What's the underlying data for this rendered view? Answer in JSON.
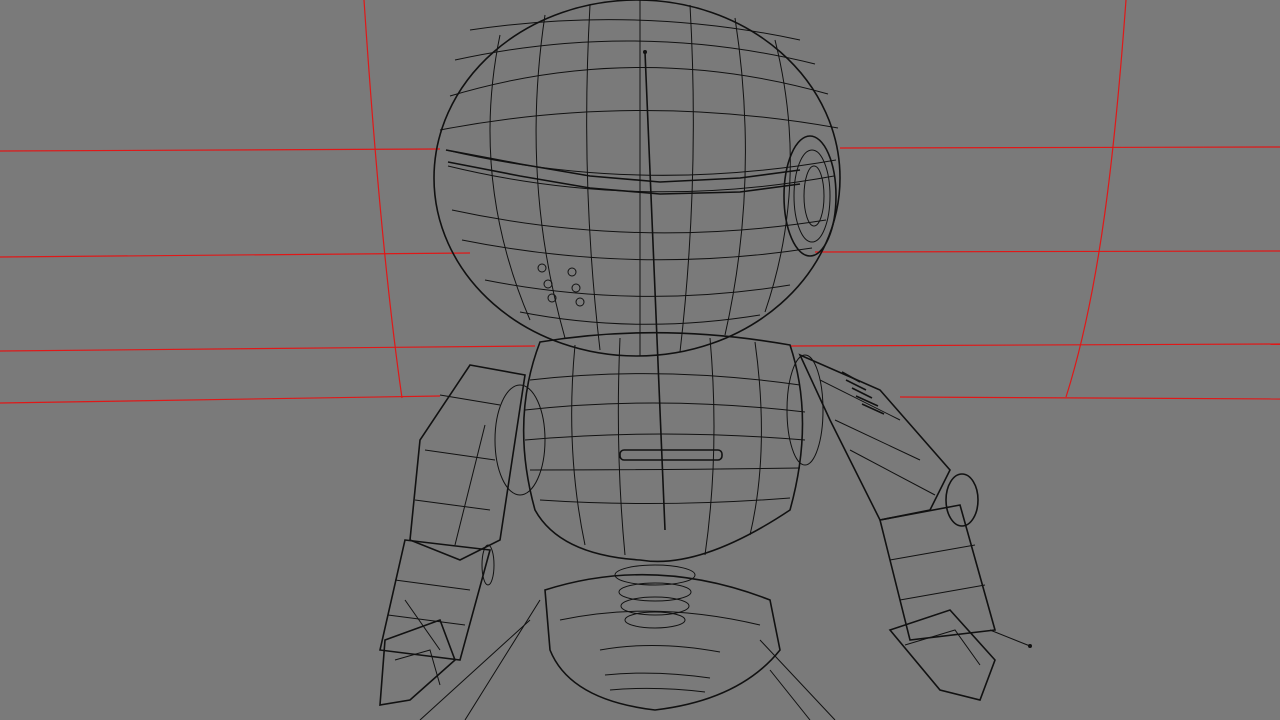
{
  "viewport": {
    "background_color": "#7a7a7a",
    "grid_line_color": "#e01818",
    "wire_color": "#111111",
    "subject": "robot-wireframe-model"
  }
}
